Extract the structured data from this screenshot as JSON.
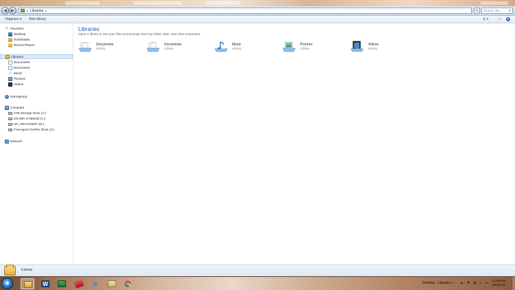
{
  "window": {
    "title_blurred_tabs": [
      "",
      "",
      "",
      ""
    ]
  },
  "address": {
    "breadcrumb_root": "Libraries",
    "search_placeholder": "Search Libr..."
  },
  "toolbar": {
    "organize": "Organize",
    "new_library": "New library"
  },
  "navpane": {
    "favorites": "Favorites",
    "favorites_items": [
      "Desktop",
      "Downloads",
      "Recent Places"
    ],
    "libraries": "Libraries",
    "libraries_items": [
      "Documents",
      "Documents",
      "Music",
      "Pictures",
      "Videos"
    ],
    "homegroup": "Homegroup",
    "computer": "Computer",
    "computer_items": [
      "2TB Storage Drive (A:)",
      "OS 800 of 980GB (C:)",
      "HP_RECOVERY (D:)",
      "FreeAgent GoFlex Drive (J:)"
    ],
    "network": "Network"
  },
  "main": {
    "title": "Libraries",
    "description": "Open a library to see your files and arrange them by folder, date, and other properties.",
    "libraries": [
      {
        "name": "Documents",
        "type": "Library",
        "icon": "documents-library-icon"
      },
      {
        "name": "Documents",
        "type": "Library",
        "icon": "documents-library-icon"
      },
      {
        "name": "Music",
        "type": "Library",
        "icon": "music-library-icon"
      },
      {
        "name": "Pictures",
        "type": "Library",
        "icon": "pictures-library-icon"
      },
      {
        "name": "Videos",
        "type": "Library",
        "icon": "videos-library-icon"
      }
    ]
  },
  "details": {
    "count": "5 items"
  },
  "taskbar": {
    "desktop_label": "Desktop",
    "libraries_label": "Libraries",
    "time": "12:38 PM",
    "date": "2/5/2019",
    "colors": {
      "accent": "#1f6fc4",
      "word": "#2a5699",
      "chrome_red": "#db4437",
      "chrome_yellow": "#f4c20d",
      "chrome_green": "#0f9d58"
    }
  }
}
